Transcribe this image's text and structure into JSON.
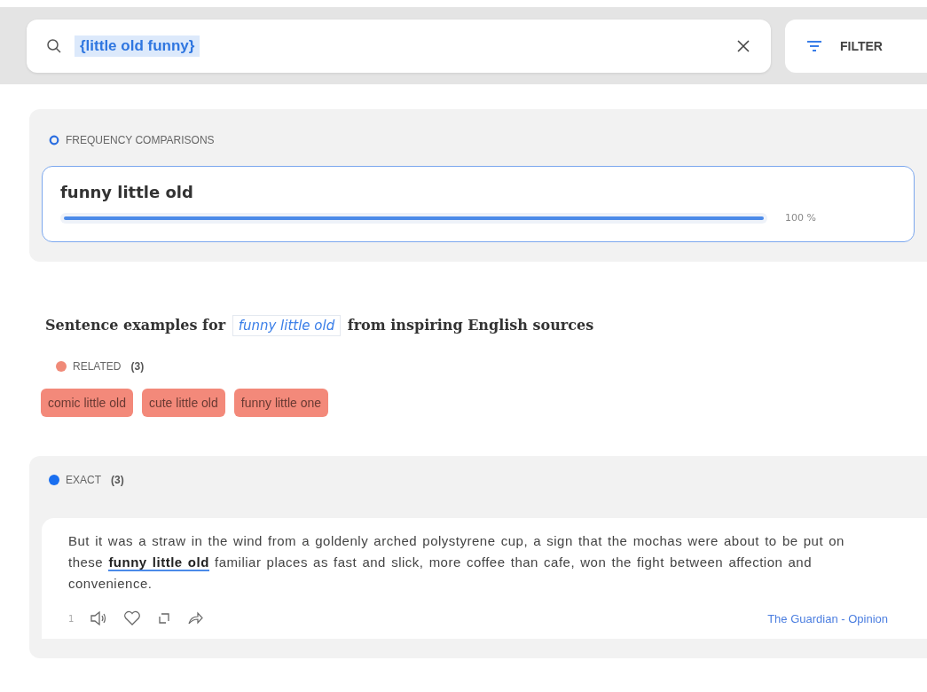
{
  "search": {
    "value": "{little old funny}",
    "value_highlighted": true
  },
  "filter_button": {
    "label": "FILTER"
  },
  "frequency": {
    "title": "FREQUENCY COMPARISONS",
    "items": [
      {
        "phrase": "funny little old",
        "level": 1,
        "reading": "100 %",
        "selected": true
      }
    ]
  },
  "heading": {
    "prefix": "Sentence examples for ",
    "term": "funny little old",
    "suffix": " from inspiring English sources"
  },
  "related": {
    "title": "RELATED",
    "count": "(3)",
    "color": "#f08a78",
    "chips": [
      "comic little old",
      "cute little old",
      "funny little one"
    ]
  },
  "exact": {
    "title": "EXACT",
    "count": "(3)",
    "color": "#1a6ff0",
    "examples": [
      {
        "text": "But it was a straw in the wind from a goldenly arched polystyrene cup, a sign that the mochas were about to be put on these **funny little old** familiar places as fast and slick, more coffee than cafe, won the fight between affection and convenience.",
        "number": "1",
        "source": "The Guardian - Opinion",
        "liked": false
      }
    ]
  }
}
